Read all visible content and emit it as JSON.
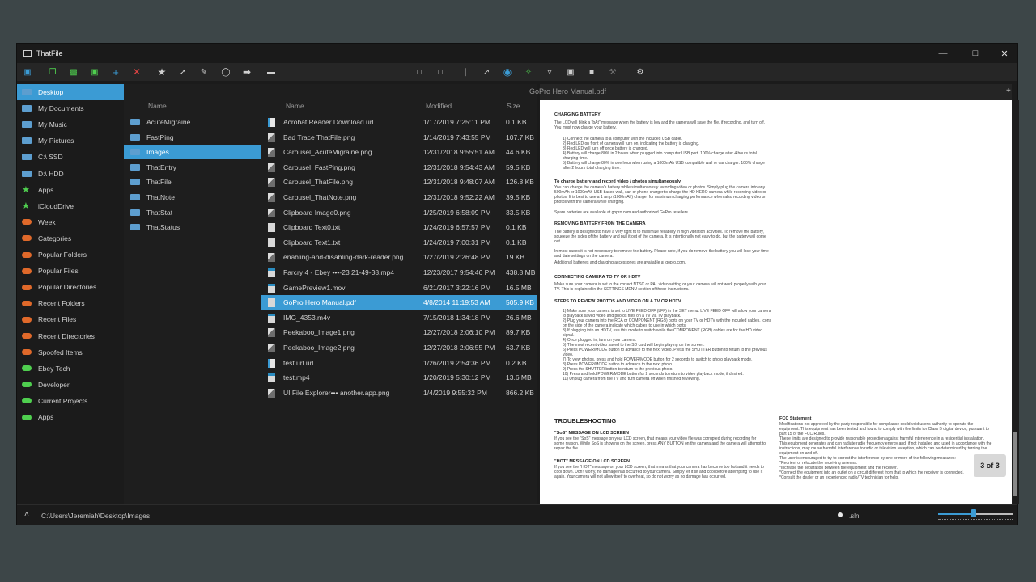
{
  "window": {
    "title": "ThatFile"
  },
  "toolbar": {
    "path_value": "GoPro Hero Manual.pdf"
  },
  "sidebar": {
    "items": [
      {
        "label": "Desktop",
        "icon": "folder-icon",
        "kind": "fold",
        "selected": true
      },
      {
        "label": "My Documents",
        "icon": "folder-icon",
        "kind": "fold"
      },
      {
        "label": "My Music",
        "icon": "folder-icon",
        "kind": "fold"
      },
      {
        "label": "My Pictures",
        "icon": "folder-icon",
        "kind": "fold"
      },
      {
        "label": "C:\\ SSD",
        "icon": "folder-icon",
        "kind": "fold"
      },
      {
        "label": "D:\\ HDD",
        "icon": "folder-icon",
        "kind": "fold"
      },
      {
        "label": "Apps",
        "icon": "star-icon",
        "kind": "star"
      },
      {
        "label": "iCloudDrive",
        "icon": "star-icon",
        "kind": "star"
      },
      {
        "label": "Week",
        "icon": "tag-icon",
        "kind": "oval"
      },
      {
        "label": "Categories",
        "icon": "tag-icon",
        "kind": "oval"
      },
      {
        "label": "Popular Folders",
        "icon": "tag-icon",
        "kind": "oval"
      },
      {
        "label": "Popular Files",
        "icon": "tag-icon",
        "kind": "oval"
      },
      {
        "label": "Popular Directories",
        "icon": "tag-icon",
        "kind": "oval"
      },
      {
        "label": "Recent Folders",
        "icon": "tag-icon",
        "kind": "oval"
      },
      {
        "label": "Recent Files",
        "icon": "tag-icon",
        "kind": "oval"
      },
      {
        "label": "Recent Directories",
        "icon": "tag-icon",
        "kind": "oval"
      },
      {
        "label": "Spoofed Items",
        "icon": "tag-icon",
        "kind": "oval"
      },
      {
        "label": "Ebey Tech",
        "icon": "tag-icon",
        "kind": "gpill"
      },
      {
        "label": "Developer",
        "icon": "tag-icon",
        "kind": "gpill"
      },
      {
        "label": "Current Projects",
        "icon": "tag-icon",
        "kind": "gpill"
      },
      {
        "label": "Apps",
        "icon": "tag-icon",
        "kind": "gpill"
      }
    ]
  },
  "folders": {
    "header": "Name",
    "items": [
      {
        "label": "AcuteMigraine"
      },
      {
        "label": "FastPing"
      },
      {
        "label": "Images",
        "selected": true
      },
      {
        "label": "ThatEntry"
      },
      {
        "label": "ThatFile"
      },
      {
        "label": "ThatNote"
      },
      {
        "label": "ThatStat"
      },
      {
        "label": "ThatStatus"
      }
    ]
  },
  "files": {
    "headers": {
      "name": "Name",
      "modified": "Modified",
      "size": "Size"
    },
    "rows": [
      {
        "name": "Acrobat Reader Download.url",
        "modified": "1/17/2019 7:25:11 PM",
        "size": "0.1 KB",
        "type": "url"
      },
      {
        "name": "Bad Trace ThatFile.png",
        "modified": "1/14/2019 7:43:55 PM",
        "size": "107.7 KB",
        "type": "img"
      },
      {
        "name": "Carousel_AcuteMigraine.png",
        "modified": "12/31/2018 9:55:51 AM",
        "size": "44.6 KB",
        "type": "img"
      },
      {
        "name": "Carousel_FastPing.png",
        "modified": "12/31/2018 9:54:43 AM",
        "size": "59.5 KB",
        "type": "img"
      },
      {
        "name": "Carousel_ThatFile.png",
        "modified": "12/31/2018 9:48:07 AM",
        "size": "126.8 KB",
        "type": "img"
      },
      {
        "name": "Carousel_ThatNote.png",
        "modified": "12/31/2018 9:52:22 AM",
        "size": "39.5 KB",
        "type": "img"
      },
      {
        "name": "Clipboard Image0.png",
        "modified": "1/25/2019 6:58:09 PM",
        "size": "33.5 KB",
        "type": "img"
      },
      {
        "name": "Clipboard Text0.txt",
        "modified": "1/24/2019 6:57:57 PM",
        "size": "0.1 KB",
        "type": "txt"
      },
      {
        "name": "Clipboard Text1.txt",
        "modified": "1/24/2019 7:00:31 PM",
        "size": "0.1 KB",
        "type": "txt"
      },
      {
        "name": "enabling-and-disabling-dark-reader.png",
        "modified": "1/27/2019 2:26:48 PM",
        "size": "19 KB",
        "type": "img"
      },
      {
        "name": "Farcry 4 - Ebey •••-23 21-49-38.mp4",
        "modified": "12/23/2017 9:54:46 PM",
        "size": "438.8 MB",
        "type": "vid"
      },
      {
        "name": "GamePreview1.mov",
        "modified": "6/21/2017 3:22:16 PM",
        "size": "16.5 MB",
        "type": "vid"
      },
      {
        "name": "GoPro Hero Manual.pdf",
        "modified": "4/8/2014 11:19:53 AM",
        "size": "505.9 KB",
        "type": "txt",
        "selected": true
      },
      {
        "name": "IMG_4353.m4v",
        "modified": "7/15/2018 1:34:18 PM",
        "size": "26.6 MB",
        "type": "vid"
      },
      {
        "name": "Peekaboo_Image1.png",
        "modified": "12/27/2018 2:06:10 PM",
        "size": "89.7 KB",
        "type": "img"
      },
      {
        "name": "Peekaboo_Image2.png",
        "modified": "12/27/2018 2:06:55 PM",
        "size": "63.7 KB",
        "type": "img"
      },
      {
        "name": "test url.url",
        "modified": "1/26/2019 2:54:36 PM",
        "size": "0.2 KB",
        "type": "url"
      },
      {
        "name": "test.mp4",
        "modified": "1/20/2019 5:30:12 PM",
        "size": "13.6 MB",
        "type": "vid"
      },
      {
        "name": "UI File Explorer••• another.app.png",
        "modified": "1/4/2019 9:55:32 PM",
        "size": "866.2 KB",
        "type": "img"
      }
    ]
  },
  "viewer": {
    "doc_title": "GoPro Hero Manual.pdf",
    "page_indicator": "3 of 3",
    "sections": {
      "charging": "CHARGING BATTERY",
      "charging_sim": "To charge battery and record video / photos simultaneously",
      "removing": "REMOVING BATTERY FROM THE CAMERA",
      "connecting": "CONNECTING CAMERA TO TV OR HDTV",
      "steps": "STEPS TO REVIEW PHOTOS AND VIDEO ON A TV OR HDTV",
      "troubleshooting": "TROUBLESHOOTING",
      "sos": "\"SoS\" MESSAGE ON LCD SCREEN",
      "hot": "\"HOT\" MESSAGE ON LCD SCREEN",
      "fcc": "FCC Statement"
    },
    "paragraphs": {
      "p1": "The LCD will blink a \"bAt\" message when the battery is low and the camera will save the file, if recording, and turn off. You must now charge your battery.",
      "p2": "1) Connect the camera to a computer with the included USB cable.\n2) Red LED on front of camera will turn on, indicating the battery is charging.\n3) Red LED will turn off once battery is charged.\n4) Battery will charge 80% in 2 hours when plugged into computer USB port. 100% charge after 4 hours total charging time.\n5) Battery will charge 80% in one hour when using a 1000mAh USB compatible wall or car charger. 100% charge after 2 hours total charging time.",
      "p3": "You can charge the camera's battery while simultaneously recording video or photos. Simply plug the camera into any 500mAh or 1000mAh USB-based wall, car, or phone charger to charge the HD HERO camera while recording video or photos. It is best to use a 1 amp (1000mAh) charger for maximum charging performance when also recording video or photos with the camera while charging.",
      "p4": "Spare batteries are available at gopro.com and authorized GoPro resellers.",
      "p5": "The battery is designed to have a very tight fit to maximize reliability in high vibration activities. To remove the battery, squeeze the sides of the battery and pull it out of the camera. It is intentionally not easy to do, but the battery will come out.",
      "p6": "In most cases it is not necessary to remove the battery. Please note, if you do remove the battery you will lose your time and date settings on the camera.",
      "p7": "Additional batteries and charging accessories are available at gopro.com.",
      "p8": "Make sure your camera is set to the correct NTSC or PAL video setting or your camera will not work properly with your TV. This is explained in the SETTINGS MENU section of these instructions.",
      "p9": "1) Make sure your camera is set to LIVE FEED OFF (LFF) in the SET menu. LIVE FEED OFF will allow your camera to playback saved video and photos files on a TV via TV playback.\n2) Plug your camera into the RCA or COMPONENT (RGB) ports on your TV or HDTV with the included cables. Icons on the side of the camera indicate which cables to use in which ports.\n3) If plugging into an HDTV, use this mode to switch while the COMPONENT (RGB) cables are for the HD video signal.\n4) Once plugged in, turn on your camera.\n5) The most recent video saved to the SD card will begin playing on the screen.\n6) Press POWER/MODE button to advance to the next video. Press the SHUTTER button to return to the previous video.\n7) To view photos, press and hold POWER/MODE button for 2 seconds to switch to photo playback mode.\n8) Press POWER/MODE button to advance to the next photo.\n9) Press the SHUTTER button to return to the previous photo.\n10) Press and hold POWER/MODE button for 2 seconds to return to video playback mode, if desired.\n11) Unplug camera from the TV and turn camera off when finished reviewing.",
      "p10": "If you see the \"SoS\" message on your LCD screen, that means your video file was corrupted during recording for some reason. While SoS is showing on the screen, press ANY BUTTON on the camera and the camera will attempt to repair the file.",
      "p11": "If you see the \"HOT\" message on your LCD screen, that means that your camera has become too hot and it needs to cool down. Don't worry, no damage has occurred to your camera. Simply let it sit and cool before attempting to use it again. Your camera will not allow itself to overheat, so do not worry as no damage has occurred.",
      "p12": "Modifications not approved by the party responsible for compliance could void user's authority to operate the equipment. This equipment has been tested and found to comply with the limits for Class B digital device, pursuant to part 15 of the FCC Rules.\nThese limits are designed to provide reasonable protection against harmful interference in a residential installation.\nThis equipment generates and can radiate radio frequency energy and, if not installed and used in accordance with the instructions, may cause harmful interference to radio or television reception, which can be determined by turning the equipment on and off.\nThe user is encouraged to try to correct the interference by one or more of the following measures:\n*Reorient or relocate the receiving antenna.\n*Increase the separation between the equipment and the receiver.\n*Connect the equipment into an outlet on a circuit different from that to which the receiver is connected.\n*Consult the dealer or an experienced radio/TV technician for help."
    }
  },
  "status": {
    "path": "C:\\Users\\Jeremiah\\Desktop\\Images",
    "ext": ".sln",
    "zoom_fraction": 0.48
  },
  "colors": {
    "accent": "#3b9bd4",
    "orange_tag": "#e0692a",
    "green_tag": "#4fcf4f"
  }
}
